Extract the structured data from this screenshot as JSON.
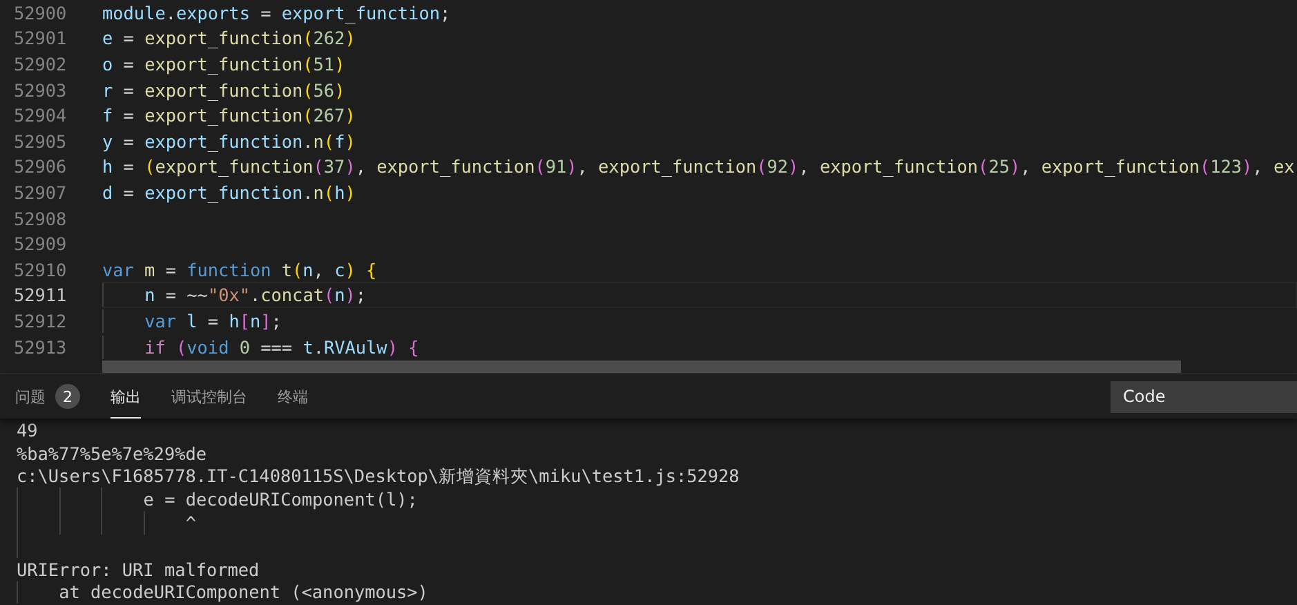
{
  "editor": {
    "lines": [
      {
        "number": "52900",
        "active": false,
        "guide": false,
        "tokens": [
          {
            "text": "module",
            "kind": "var"
          },
          {
            "text": ".",
            "kind": "p"
          },
          {
            "text": "exports",
            "kind": "var"
          },
          {
            "text": " = ",
            "kind": "p"
          },
          {
            "text": "export_function",
            "kind": "var"
          },
          {
            "text": ";",
            "kind": "p"
          }
        ]
      },
      {
        "number": "52901",
        "active": false,
        "guide": false,
        "tokens": [
          {
            "text": "e",
            "kind": "var"
          },
          {
            "text": " = ",
            "kind": "p"
          },
          {
            "text": "export_function",
            "kind": "fn"
          },
          {
            "text": "(",
            "kind": "b1"
          },
          {
            "text": "262",
            "kind": "num"
          },
          {
            "text": ")",
            "kind": "b1"
          }
        ]
      },
      {
        "number": "52902",
        "active": false,
        "guide": false,
        "tokens": [
          {
            "text": "o",
            "kind": "var"
          },
          {
            "text": " = ",
            "kind": "p"
          },
          {
            "text": "export_function",
            "kind": "fn"
          },
          {
            "text": "(",
            "kind": "b1"
          },
          {
            "text": "51",
            "kind": "num"
          },
          {
            "text": ")",
            "kind": "b1"
          }
        ]
      },
      {
        "number": "52903",
        "active": false,
        "guide": false,
        "tokens": [
          {
            "text": "r",
            "kind": "var"
          },
          {
            "text": " = ",
            "kind": "p"
          },
          {
            "text": "export_function",
            "kind": "fn"
          },
          {
            "text": "(",
            "kind": "b1"
          },
          {
            "text": "56",
            "kind": "num"
          },
          {
            "text": ")",
            "kind": "b1"
          }
        ]
      },
      {
        "number": "52904",
        "active": false,
        "guide": false,
        "tokens": [
          {
            "text": "f",
            "kind": "var"
          },
          {
            "text": " = ",
            "kind": "p"
          },
          {
            "text": "export_function",
            "kind": "fn"
          },
          {
            "text": "(",
            "kind": "b1"
          },
          {
            "text": "267",
            "kind": "num"
          },
          {
            "text": ")",
            "kind": "b1"
          }
        ]
      },
      {
        "number": "52905",
        "active": false,
        "guide": false,
        "tokens": [
          {
            "text": "y",
            "kind": "var"
          },
          {
            "text": " = ",
            "kind": "p"
          },
          {
            "text": "export_function",
            "kind": "var"
          },
          {
            "text": ".",
            "kind": "p"
          },
          {
            "text": "n",
            "kind": "fn"
          },
          {
            "text": "(",
            "kind": "b1"
          },
          {
            "text": "f",
            "kind": "var"
          },
          {
            "text": ")",
            "kind": "b1"
          }
        ]
      },
      {
        "number": "52906",
        "active": false,
        "guide": false,
        "tokens": [
          {
            "text": "h",
            "kind": "var"
          },
          {
            "text": " = ",
            "kind": "p"
          },
          {
            "text": "(",
            "kind": "b1"
          },
          {
            "text": "export_function",
            "kind": "fn"
          },
          {
            "text": "(",
            "kind": "b2"
          },
          {
            "text": "37",
            "kind": "num"
          },
          {
            "text": ")",
            "kind": "b2"
          },
          {
            "text": ", ",
            "kind": "p"
          },
          {
            "text": "export_function",
            "kind": "fn"
          },
          {
            "text": "(",
            "kind": "b2"
          },
          {
            "text": "91",
            "kind": "num"
          },
          {
            "text": ")",
            "kind": "b2"
          },
          {
            "text": ", ",
            "kind": "p"
          },
          {
            "text": "export_function",
            "kind": "fn"
          },
          {
            "text": "(",
            "kind": "b2"
          },
          {
            "text": "92",
            "kind": "num"
          },
          {
            "text": ")",
            "kind": "b2"
          },
          {
            "text": ", ",
            "kind": "p"
          },
          {
            "text": "export_function",
            "kind": "fn"
          },
          {
            "text": "(",
            "kind": "b2"
          },
          {
            "text": "25",
            "kind": "num"
          },
          {
            "text": ")",
            "kind": "b2"
          },
          {
            "text": ", ",
            "kind": "p"
          },
          {
            "text": "export_function",
            "kind": "fn"
          },
          {
            "text": "(",
            "kind": "b2"
          },
          {
            "text": "123",
            "kind": "num"
          },
          {
            "text": ")",
            "kind": "b2"
          },
          {
            "text": ", ",
            "kind": "p"
          },
          {
            "text": "ex",
            "kind": "fn"
          }
        ]
      },
      {
        "number": "52907",
        "active": false,
        "guide": false,
        "tokens": [
          {
            "text": "d",
            "kind": "var"
          },
          {
            "text": " = ",
            "kind": "p"
          },
          {
            "text": "export_function",
            "kind": "var"
          },
          {
            "text": ".",
            "kind": "p"
          },
          {
            "text": "n",
            "kind": "fn"
          },
          {
            "text": "(",
            "kind": "b1"
          },
          {
            "text": "h",
            "kind": "var"
          },
          {
            "text": ")",
            "kind": "b1"
          }
        ]
      },
      {
        "number": "52908",
        "active": false,
        "guide": false
      },
      {
        "number": "52909",
        "active": false,
        "guide": false
      },
      {
        "number": "52910",
        "active": false,
        "guide": false,
        "tokens": [
          {
            "text": "var",
            "kind": "kw"
          },
          {
            "text": " m",
            "kind": "fn"
          },
          {
            "text": " = ",
            "kind": "p"
          },
          {
            "text": "function",
            "kind": "kw"
          },
          {
            "text": " t",
            "kind": "fn"
          },
          {
            "text": "(",
            "kind": "b1"
          },
          {
            "text": "n",
            "kind": "var"
          },
          {
            "text": ", ",
            "kind": "p"
          },
          {
            "text": "c",
            "kind": "var"
          },
          {
            "text": ")",
            "kind": "b1"
          },
          {
            "text": " {",
            "kind": "b1"
          }
        ]
      },
      {
        "number": "52911",
        "active": true,
        "guide": true,
        "tokens": [
          {
            "text": "n",
            "kind": "var"
          },
          {
            "text": " = ~~",
            "kind": "p"
          },
          {
            "text": "\"0x\"",
            "kind": "str"
          },
          {
            "text": ".",
            "kind": "p"
          },
          {
            "text": "concat",
            "kind": "fn"
          },
          {
            "text": "(",
            "kind": "b2"
          },
          {
            "text": "n",
            "kind": "var"
          },
          {
            "text": ")",
            "kind": "b2"
          },
          {
            "text": ";",
            "kind": "p"
          }
        ]
      },
      {
        "number": "52912",
        "active": false,
        "guide": true,
        "tokens": [
          {
            "text": "var",
            "kind": "kw"
          },
          {
            "text": " l",
            "kind": "var"
          },
          {
            "text": " = ",
            "kind": "p"
          },
          {
            "text": "h",
            "kind": "var"
          },
          {
            "text": "[",
            "kind": "b2"
          },
          {
            "text": "n",
            "kind": "var"
          },
          {
            "text": "]",
            "kind": "b2"
          },
          {
            "text": ";",
            "kind": "p"
          }
        ]
      },
      {
        "number": "52913",
        "active": false,
        "guide": true,
        "tokens": [
          {
            "text": "if",
            "kind": "ctl"
          },
          {
            "text": " (",
            "kind": "b2"
          },
          {
            "text": "void",
            "kind": "kw"
          },
          {
            "text": " 0",
            "kind": "num"
          },
          {
            "text": " === ",
            "kind": "p"
          },
          {
            "text": "t",
            "kind": "var"
          },
          {
            "text": ".",
            "kind": "p"
          },
          {
            "text": "RVAulw",
            "kind": "var"
          },
          {
            "text": ")",
            "kind": "b2"
          },
          {
            "text": " {",
            "kind": "b2"
          }
        ]
      }
    ]
  },
  "panel": {
    "tabs": [
      {
        "label": "问题",
        "badge": "2",
        "selected": false
      },
      {
        "label": "输出",
        "selected": true
      },
      {
        "label": "调试控制台",
        "selected": false
      },
      {
        "label": "终端",
        "selected": false
      }
    ],
    "channel_select": {
      "value": "Code"
    },
    "output": [
      {
        "kind": "text",
        "text": "49"
      },
      {
        "kind": "text",
        "text": "%ba%77%5e%7e%29%de"
      },
      {
        "kind": "text",
        "text": "c:\\Users\\F1685778.IT-C14080115S\\Desktop\\新增資料夾\\miku\\test1.js:52928"
      },
      {
        "kind": "text",
        "text": "            e = decodeURIComponent(l);"
      },
      {
        "kind": "text",
        "text": "                ^"
      },
      {
        "kind": "blank"
      },
      {
        "kind": "text",
        "text": "URIError: URI malformed"
      },
      {
        "kind": "text",
        "text": "    at decodeURIComponent (<anonymous>)"
      }
    ]
  }
}
